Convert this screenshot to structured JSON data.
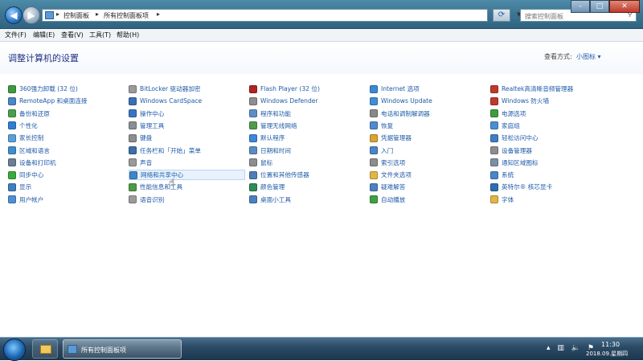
{
  "address_bar": {
    "crumbs": [
      "控制面板",
      "所有控制面板项"
    ],
    "search_placeholder": "搜索控制面板"
  },
  "menu": [
    "文件(F)",
    "编辑(E)",
    "查看(V)",
    "工具(T)",
    "帮助(H)"
  ],
  "header": {
    "title": "调整计算机的设置",
    "view_label": "查看方式:",
    "view_value": "小图标 ▾"
  },
  "columns": [
    [
      {
        "label": "360强力卸载 (32 位)",
        "color": "#3d9b3d"
      },
      {
        "label": "RemoteApp 和桌面连接",
        "color": "#4a86c8"
      },
      {
        "label": "备份和还原",
        "color": "#4aa04a"
      },
      {
        "label": "个性化",
        "color": "#2f7fd0"
      },
      {
        "label": "家长控制",
        "color": "#5aa0d8"
      },
      {
        "label": "区域和语言",
        "color": "#3f8ecf"
      },
      {
        "label": "设备和打印机",
        "color": "#6a7f93"
      },
      {
        "label": "同步中心",
        "color": "#3caa3c"
      },
      {
        "label": "显示",
        "color": "#3d7fc0"
      },
      {
        "label": "用户帐户",
        "color": "#4f8fd5"
      }
    ],
    [
      {
        "label": "BitLocker 驱动器加密",
        "color": "#9a9a9a"
      },
      {
        "label": "Windows CardSpace",
        "color": "#3b6fb5"
      },
      {
        "label": "操作中心",
        "color": "#3b73c2"
      },
      {
        "label": "管理工具",
        "color": "#8a8f96"
      },
      {
        "label": "键盘",
        "color": "#8e8e8e"
      },
      {
        "label": "任务栏和「开始」菜单",
        "color": "#3d6fa8"
      },
      {
        "label": "声音",
        "color": "#9a9a9a"
      },
      {
        "label": "网络和共享中心",
        "color": "#3f86c9"
      },
      {
        "label": "性能信息和工具",
        "color": "#4c9b46"
      },
      {
        "label": "语音识别",
        "color": "#9b9b9b"
      }
    ],
    [
      {
        "label": "Flash Player (32 位)",
        "color": "#b22222"
      },
      {
        "label": "Windows Defender",
        "color": "#8d8d8d"
      },
      {
        "label": "程序和功能",
        "color": "#5d8fc7"
      },
      {
        "label": "管理无线网络",
        "color": "#4e9c4e"
      },
      {
        "label": "默认程序",
        "color": "#3c87d8"
      },
      {
        "label": "日期和时间",
        "color": "#5a8bc5"
      },
      {
        "label": "鼠标",
        "color": "#8e8e8e"
      },
      {
        "label": "位置和其他传感器",
        "color": "#4b7fb8"
      },
      {
        "label": "颜色管理",
        "color": "#2e8b57"
      },
      {
        "label": "桌面小工具",
        "color": "#4a7fc0"
      }
    ],
    [
      {
        "label": "Internet 选项",
        "color": "#3a8ad2"
      },
      {
        "label": "Windows Update",
        "color": "#3f8fd6"
      },
      {
        "label": "电话和调制解调器",
        "color": "#888888"
      },
      {
        "label": "恢复",
        "color": "#4f8bd0"
      },
      {
        "label": "凭据管理器",
        "color": "#d9a434"
      },
      {
        "label": "入门",
        "color": "#4a86c8"
      },
      {
        "label": "索引选项",
        "color": "#8d8d8d"
      },
      {
        "label": "文件夹选项",
        "color": "#e2b545"
      },
      {
        "label": "疑难解答",
        "color": "#4b82c3"
      },
      {
        "label": "自动播放",
        "color": "#3fa040"
      }
    ],
    [
      {
        "label": "Realtek高清晰音频管理器",
        "color": "#c0392b"
      },
      {
        "label": "Windows 防火墙",
        "color": "#c0392b"
      },
      {
        "label": "电源选项",
        "color": "#3f9b3f"
      },
      {
        "label": "家庭组",
        "color": "#4a90d0"
      },
      {
        "label": "轻松访问中心",
        "color": "#3f7fc5"
      },
      {
        "label": "设备管理器",
        "color": "#8e8e8e"
      },
      {
        "label": "通知区域图标",
        "color": "#7d8fa3"
      },
      {
        "label": "系统",
        "color": "#4a86c8"
      },
      {
        "label": "英特尔® 核芯显卡",
        "color": "#2d6fb2"
      },
      {
        "label": "字体",
        "color": "#e2b545"
      }
    ]
  ],
  "taskbar": {
    "task_label": "所有控制面板项",
    "time": "11:30",
    "date": "2018.09.星期四"
  }
}
